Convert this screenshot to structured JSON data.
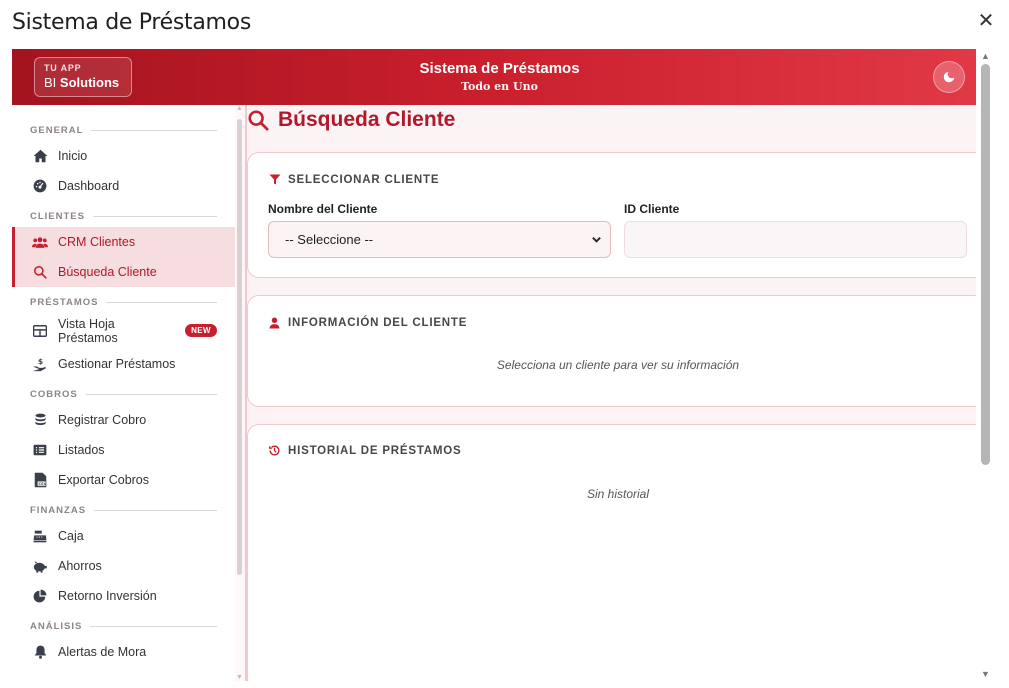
{
  "window": {
    "title": "Sistema de Préstamos",
    "close_icon": "close-icon"
  },
  "header": {
    "brand_top": "TU APP",
    "brand_prefix": "BI",
    "brand_name": "Solutions",
    "title": "Sistema de Préstamos",
    "subtitle": "Todo en Uno",
    "theme_icon": "moon-icon",
    "gradient": [
      "#a3141f",
      "#c81e2c",
      "#e23947"
    ]
  },
  "sidebar": {
    "sections": [
      {
        "label": "GENERAL",
        "items": [
          {
            "label": "Inicio",
            "icon": "home-icon"
          },
          {
            "label": "Dashboard",
            "icon": "gauge-icon"
          }
        ]
      },
      {
        "label": "CLIENTES",
        "items": [
          {
            "label": "CRM Clientes",
            "icon": "users-icon",
            "active": true
          },
          {
            "label": "Búsqueda Cliente",
            "icon": "search-icon",
            "active": true
          }
        ]
      },
      {
        "label": "PRÉSTAMOS",
        "items": [
          {
            "label": "Vista Hoja Préstamos",
            "icon": "table-icon",
            "badge": "NEW"
          },
          {
            "label": "Gestionar Préstamos",
            "icon": "hand-coins-icon"
          }
        ]
      },
      {
        "label": "COBROS",
        "items": [
          {
            "label": "Registrar Cobro",
            "icon": "coins-icon"
          },
          {
            "label": "Listados",
            "icon": "list-icon"
          },
          {
            "label": "Exportar Cobros",
            "icon": "file-csv-icon"
          }
        ]
      },
      {
        "label": "FINANZAS",
        "items": [
          {
            "label": "Caja",
            "icon": "cash-register-icon"
          },
          {
            "label": "Ahorros",
            "icon": "piggy-bank-icon"
          },
          {
            "label": "Retorno Inversión",
            "icon": "pie-chart-icon"
          }
        ]
      },
      {
        "label": "ANÁLISIS",
        "items": [
          {
            "label": "Alertas de Mora",
            "icon": "bell-icon"
          }
        ]
      }
    ]
  },
  "main": {
    "page_title": "Búsqueda Cliente",
    "select_card": {
      "heading": "SELECCIONAR CLIENTE",
      "name_label": "Nombre del Cliente",
      "name_value": "-- Seleccione --",
      "id_label": "ID Cliente",
      "id_value": ""
    },
    "info_card": {
      "heading": "INFORMACIÓN DEL CLIENTE",
      "empty": "Selecciona un cliente para ver su información"
    },
    "history_card": {
      "heading": "HISTORIAL DE PRÉSTAMOS",
      "empty": "Sin historial"
    }
  },
  "colors": {
    "accent": "#c51f30",
    "active_bg": "#f6dde0",
    "page_bg": "#fbf3f4",
    "card_border": "#f1c9cd"
  }
}
